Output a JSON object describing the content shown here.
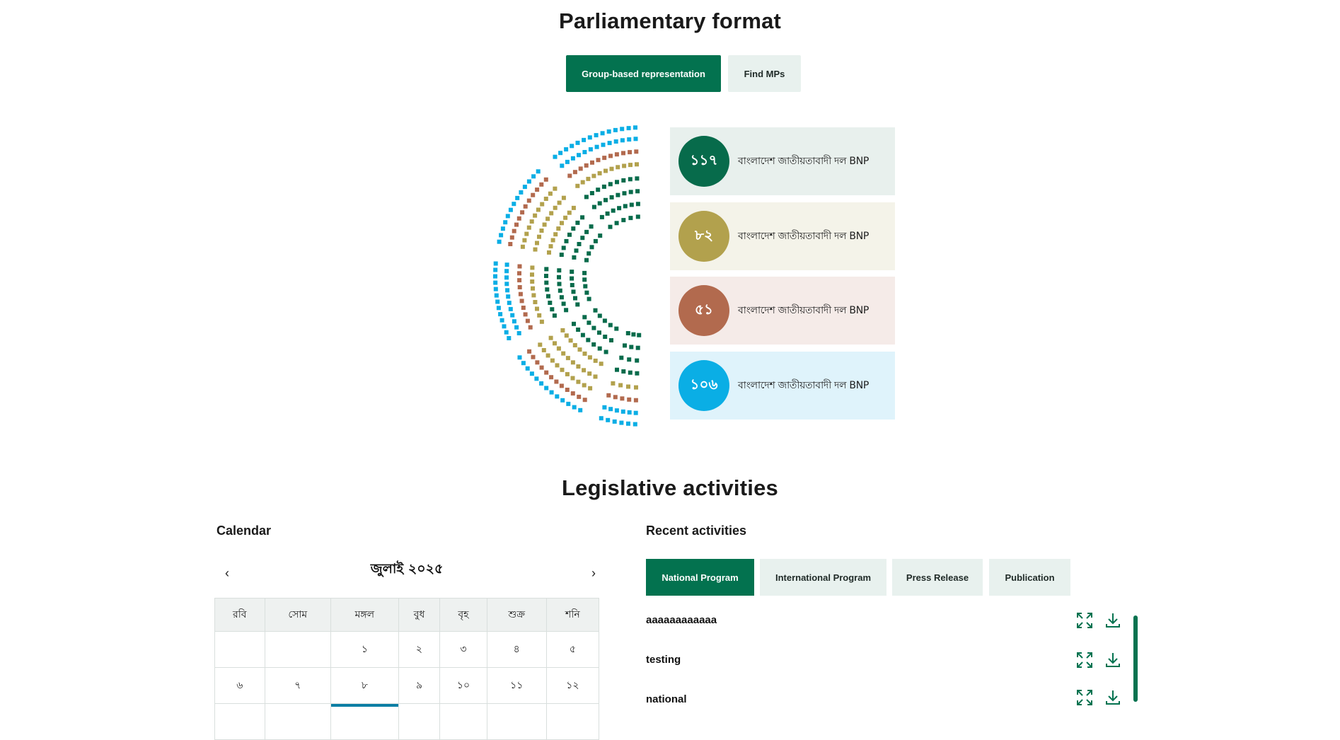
{
  "parliament": {
    "title": "Parliamentary format",
    "tabs": [
      {
        "label": "Group-based representation",
        "active": true
      },
      {
        "label": "Find MPs",
        "active": false
      }
    ],
    "parties": [
      {
        "count": "১১৭",
        "name": "বাংলাদেশ জাতীয়তাবাদী দল BNP",
        "color": "#076b4b",
        "bg": "#e8f0ed"
      },
      {
        "count": "৮২",
        "name": "বাংলাদেশ জাতীয়তাবাদী দল BNP",
        "color": "#b2a14d",
        "bg": "#f4f3e9"
      },
      {
        "count": "৫১",
        "name": "বাংলাদেশ জাতীয়তাবাদী দল BNP",
        "color": "#b26a4e",
        "bg": "#f5ebe8"
      },
      {
        "count": "১০৬",
        "name": "বাংলাদেশ জাতীয়তাবাদী দল BNP",
        "color": "#0aaee5",
        "bg": "#dff3fb"
      }
    ]
  },
  "legislative": {
    "title": "Legislative activities",
    "calendar": {
      "label": "Calendar",
      "month": "জুলাই ২০২৫",
      "prev": "‹",
      "next": "›",
      "weekdays": [
        "রবি",
        "সোম",
        "মঙ্গল",
        "বুধ",
        "বৃহ",
        "শুক্র",
        "শনি"
      ],
      "weeks": [
        [
          "",
          "",
          "১",
          "২",
          "৩",
          "৪",
          "৫"
        ],
        [
          "৬",
          "৭",
          "৮",
          "৯",
          "১০",
          "১১",
          "১২"
        ]
      ],
      "highlight_color": "#0a7ea4"
    },
    "recent": {
      "label": "Recent activities",
      "tabs": [
        {
          "label": "National Program",
          "active": true
        },
        {
          "label": "International Program",
          "active": false
        },
        {
          "label": "Press Release",
          "active": false
        },
        {
          "label": "Publication",
          "active": false
        }
      ],
      "items": [
        {
          "title": "aaaaaaaaaaaa"
        },
        {
          "title": "testing"
        },
        {
          "title": "national"
        }
      ]
    }
  },
  "colors": {
    "accent": "#03724f",
    "tab_inactive_bg": "#e8f1ee"
  }
}
